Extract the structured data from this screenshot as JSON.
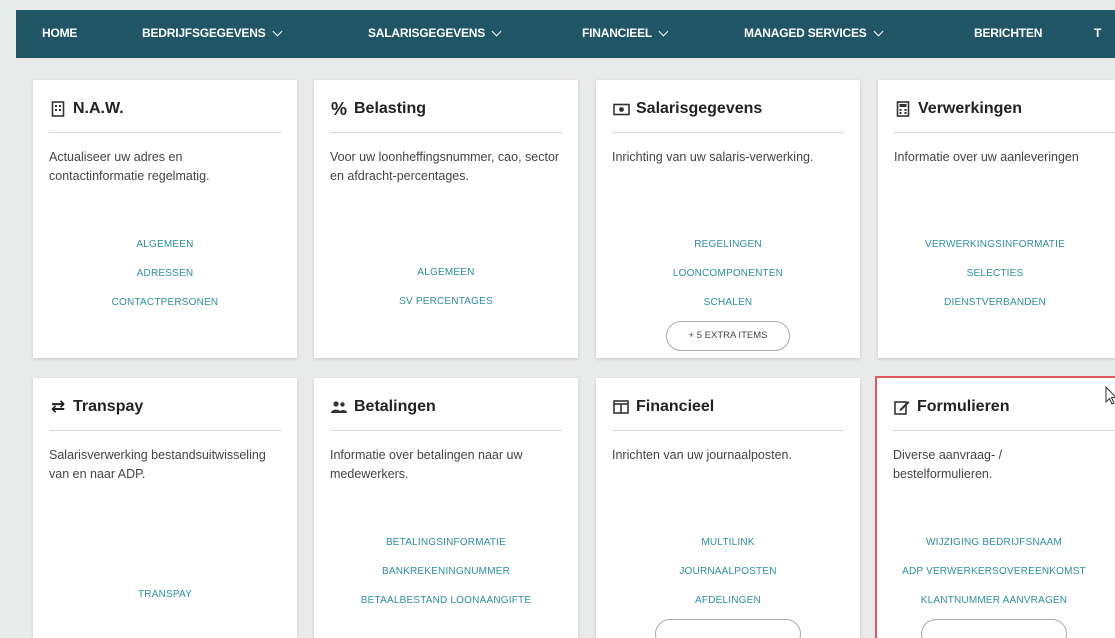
{
  "nav": {
    "items": [
      {
        "label": "HOME",
        "dropdown": false
      },
      {
        "label": "BEDRIJFSGEGEVENS",
        "dropdown": true
      },
      {
        "label": "SALARISGEGEVENS",
        "dropdown": true
      },
      {
        "label": "FINANCIEEL",
        "dropdown": true
      },
      {
        "label": "MANAGED SERVICES",
        "dropdown": true
      },
      {
        "label": "BERICHTEN",
        "dropdown": false
      },
      {
        "label": "T",
        "dropdown": false
      }
    ]
  },
  "cards": [
    {
      "title": "N.A.W.",
      "icon": "building-icon",
      "description": "Actualiseer uw adres en contactinformatie regelmatig.",
      "links": [
        "ALGEMEEN",
        "ADRESSEN",
        "CONTACTPERSONEN"
      ]
    },
    {
      "title": "Belasting",
      "icon": "percent-icon",
      "description": "Voor uw loonheffingsnummer, cao, sector en afdracht-percentages.",
      "links": [
        "ALGEMEEN",
        "SV PERCENTAGES"
      ]
    },
    {
      "title": "Salarisgegevens",
      "icon": "money-icon",
      "description": "Inrichting van uw salaris-verwerking.",
      "links": [
        "REGELINGEN",
        "LOONCOMPONENTEN",
        "SCHALEN"
      ],
      "extra": "+ 5 EXTRA ITEMS"
    },
    {
      "title": "Verwerkingen",
      "icon": "calculator-icon",
      "description": "Informatie over uw aanleveringen",
      "links": [
        "VERWERKINGSINFORMATIE",
        "SELECTIES",
        "DIENSTVERBANDEN"
      ]
    },
    {
      "title": "Transpay",
      "icon": "exchange-icon",
      "description": "Salarisverwerking bestandsuitwisseling van en naar ADP.",
      "links": [
        "TRANSPAY"
      ]
    },
    {
      "title": "Betalingen",
      "icon": "users-icon",
      "description": "Informatie over betalingen naar uw medewerkers.",
      "links": [
        "BETALINGSINFORMATIE",
        "BANKREKENINGNUMMER",
        "BETAALBESTAND LOONAANGIFTE"
      ]
    },
    {
      "title": "Financieel",
      "icon": "columns-icon",
      "description": "Inrichten van uw journaalposten.",
      "links": [
        "MULTILINK",
        "JOURNAALPOSTEN",
        "AFDELINGEN"
      ],
      "extra": ""
    },
    {
      "title": "Formulieren",
      "icon": "edit-icon",
      "description": "Diverse aanvraag- / bestelformulieren.",
      "links": [
        "WIJZIGING BEDRIJFSNAAM",
        "ADP VERWERKERSOVEREENKOMST",
        "KLANTNUMMER AANVRAGEN"
      ],
      "extra": ""
    }
  ],
  "colors": {
    "nav_bg": "#1f5564",
    "link": "#2d8fa3",
    "highlight": "#e25b5b"
  }
}
